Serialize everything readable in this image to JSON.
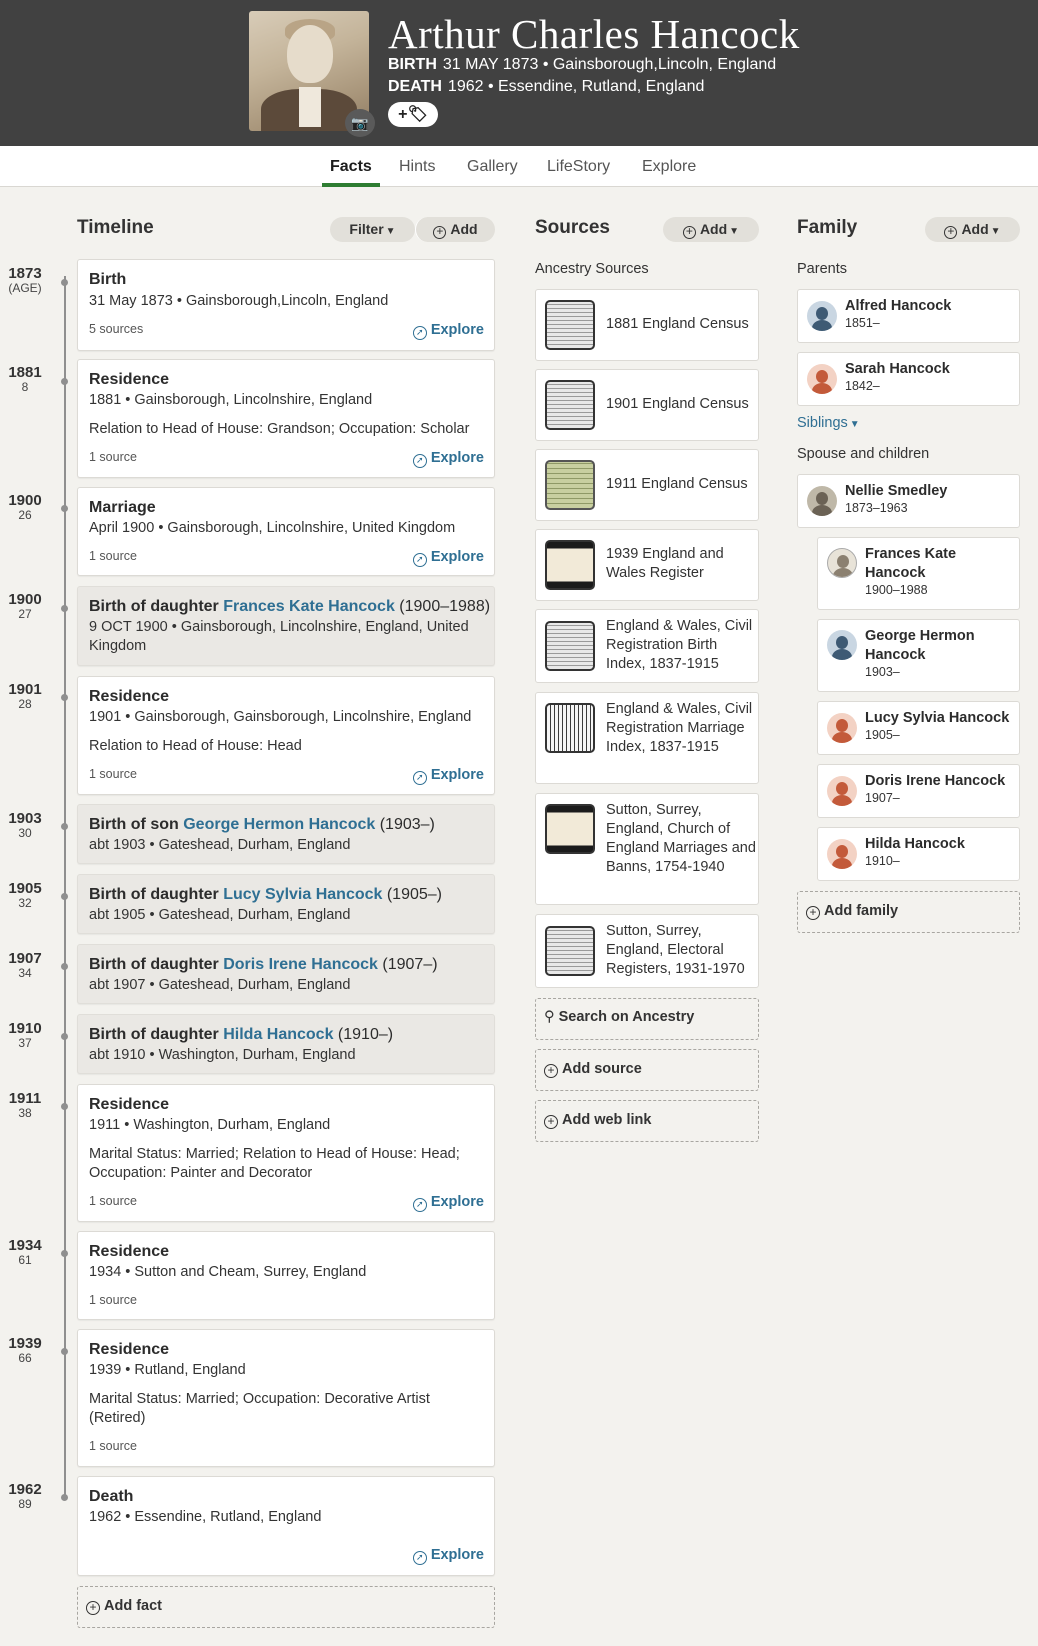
{
  "header": {
    "name": "Arthur Charles Hancock",
    "birth_label": "BIRTH",
    "birth_value": "31 MAY 1873 • Gainsborough,Lincoln, England",
    "death_label": "DEATH",
    "death_value": "1962 • Essendine, Rutland, England",
    "camera_icon": "📷",
    "tag_button": "+🏷"
  },
  "tabs": [
    "Facts",
    "Hints",
    "Gallery",
    "LifeStory",
    "Explore"
  ],
  "timeline": {
    "title": "Timeline",
    "filter_label": "Filter",
    "add_label": "Add",
    "add_fact_label": "Add fact",
    "explore_label": "Explore",
    "events": [
      {
        "year": "1873",
        "age": "(AGE)",
        "title": "Birth",
        "detail": "31 May 1873 • Gainsborough,Lincoln, England",
        "note": "",
        "sources": "5 sources",
        "explore": true
      },
      {
        "year": "1881",
        "age": "8",
        "title": "Residence",
        "detail": "1881 • Gainsborough, Lincolnshire, England",
        "note": "Relation to Head of House: Grandson; Occupation: Scholar",
        "sources": "1 source",
        "explore": true
      },
      {
        "year": "1900",
        "age": "26",
        "title": "Marriage",
        "detail": "April 1900 • Gainsborough, Lincolnshire, United Kingdom",
        "note": "",
        "sources": "1 source",
        "explore": true
      },
      {
        "year": "1900",
        "age": "27",
        "title_prefix": "Birth of daughter ",
        "link": "Frances Kate Hancock",
        "dates": " (1900–1988)",
        "detail": "9 OCT 1900 • Gainsborough, Lincolnshire, England, United Kingdom"
      },
      {
        "year": "1901",
        "age": "28",
        "title": "Residence",
        "detail": "1901 • Gainsborough, Gainsborough, Lincolnshire, England",
        "note": "Relation to Head of House: Head",
        "sources": "1 source",
        "explore": true
      },
      {
        "year": "1903",
        "age": "30",
        "title_prefix": "Birth of son ",
        "link": "George Hermon Hancock",
        "dates": " (1903–)",
        "detail": "abt 1903 • Gateshead, Durham, England"
      },
      {
        "year": "1905",
        "age": "32",
        "title_prefix": "Birth of daughter ",
        "link": "Lucy Sylvia Hancock",
        "dates": " (1905–)",
        "detail": "abt 1905 • Gateshead, Durham, England"
      },
      {
        "year": "1907",
        "age": "34",
        "title_prefix": "Birth of daughter ",
        "link": "Doris Irene Hancock",
        "dates": " (1907–)",
        "detail": "abt 1907 • Gateshead, Durham, England"
      },
      {
        "year": "1910",
        "age": "37",
        "title_prefix": "Birth of daughter ",
        "link": "Hilda Hancock",
        "dates": " (1910–)",
        "detail": "abt 1910 • Washington, Durham, England"
      },
      {
        "year": "1911",
        "age": "38",
        "title": "Residence",
        "detail": "1911 • Washington, Durham, England",
        "note": "Marital Status: Married; Relation to Head of House: Head; Occupation: Painter and Decorator",
        "sources": "1 source",
        "explore": true
      },
      {
        "year": "1934",
        "age": "61",
        "title": "Residence",
        "detail": "1934 • Sutton and Cheam, Surrey, England",
        "note": "",
        "sources": "1 source",
        "explore": false
      },
      {
        "year": "1939",
        "age": "66",
        "title": "Residence",
        "detail": "1939 • Rutland, England",
        "note": "Marital Status: Married; Occupation: Decorative Artist (Retired)",
        "sources": "1 source",
        "explore": false
      },
      {
        "year": "1962",
        "age": "89",
        "title": "Death",
        "detail": "1962 • Essendine, Rutland, England",
        "note": "",
        "sources": "",
        "explore": true
      }
    ]
  },
  "sources": {
    "title": "Sources",
    "add_label": "Add",
    "subtitle": "Ancestry Sources",
    "items": [
      "1881 England Census",
      "1901 England Census",
      "1911 England Census",
      "1939 England and Wales Register",
      "England & Wales, Civil Registration Birth Index, 1837-1915",
      "England & Wales, Civil Registration Marriage Index, 1837-1915",
      "Sutton, Surrey, England, Church of England Marriages and Banns, 1754-1940",
      "Sutton, Surrey, England, Electoral Registers, 1931-1970"
    ],
    "search_label": "Search on Ancestry",
    "add_source_label": "Add source",
    "add_web_label": "Add web link"
  },
  "family": {
    "title": "Family",
    "add_label": "Add",
    "parents_label": "Parents",
    "parents": [
      {
        "name": "Alfred Hancock",
        "dates": "1851–"
      },
      {
        "name": "Sarah Hancock",
        "dates": "1842–"
      }
    ],
    "siblings_label": "Siblings",
    "spouse_label": "Spouse and children",
    "spouse": {
      "name": "Nellie Smedley",
      "dates": "1873–1963"
    },
    "children": [
      {
        "name": "Frances Kate Hancock",
        "dates": "1900–1988"
      },
      {
        "name": "George Hermon Hancock",
        "dates": "1903–"
      },
      {
        "name": "Lucy Sylvia Hancock",
        "dates": "1905–"
      },
      {
        "name": "Doris Irene Hancock",
        "dates": "1907–"
      },
      {
        "name": "Hilda Hancock",
        "dates": "1910–"
      }
    ],
    "add_family_label": "Add family"
  }
}
